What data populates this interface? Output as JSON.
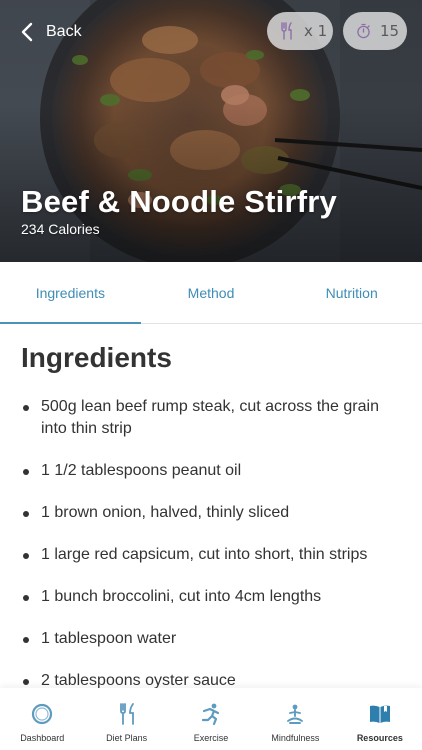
{
  "header": {
    "back_label": "Back",
    "servings": "x 1",
    "timer": "15",
    "recipe_title": "Beef & Noodle Stirfry",
    "calories": "234 Calories"
  },
  "tabs": [
    {
      "label": "Ingredients",
      "active": true
    },
    {
      "label": "Method",
      "active": false
    },
    {
      "label": "Nutrition",
      "active": false
    }
  ],
  "section_title": "Ingredients",
  "ingredients": [
    "500g lean beef rump steak, cut across the grain into thin strip",
    "1 1/2 tablespoons peanut oil",
    "1 brown onion, halved, thinly sliced",
    "1 large red capsicum, cut into short, thin strips",
    "1 bunch broccolini, cut into 4cm lengths",
    "1 tablespoon water",
    "2 tablespoons oyster sauce"
  ],
  "bottom_nav": [
    {
      "label": "Dashboard",
      "icon": "dashboard-ring-icon",
      "active": false
    },
    {
      "label": "Diet Plans",
      "icon": "fork-knife-icon",
      "active": false
    },
    {
      "label": "Exercise",
      "icon": "running-person-icon",
      "active": false
    },
    {
      "label": "Mindfulness",
      "icon": "meditation-icon",
      "active": false
    },
    {
      "label": "Resources",
      "icon": "book-icon",
      "active": true
    }
  ],
  "colors": {
    "accent": "#3f8db5",
    "nav_icon": "#5d9bc0",
    "nav_icon_active": "#2e7fae",
    "text": "#333333"
  }
}
